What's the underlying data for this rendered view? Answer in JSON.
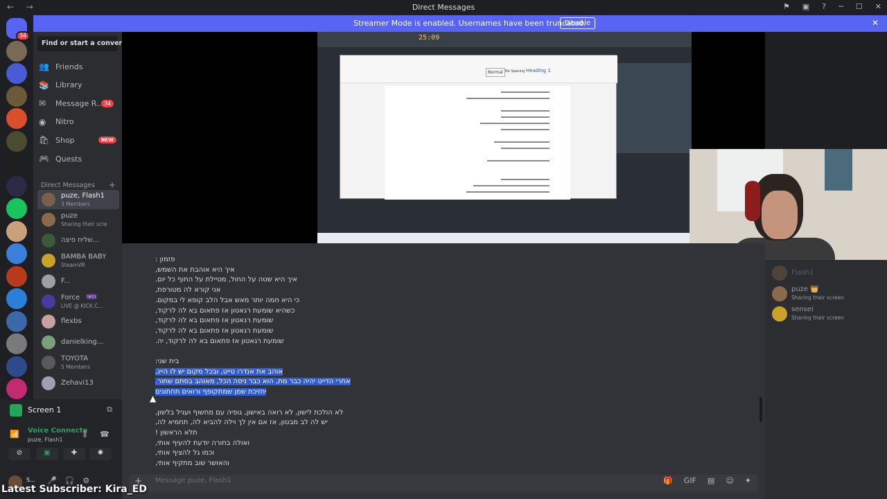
{
  "window": {
    "title": "Direct Messages",
    "back": "←",
    "forward": "→",
    "controls": [
      "─",
      "☐",
      "✕"
    ],
    "toolbar_icons": [
      "⚑",
      "▣",
      "?"
    ]
  },
  "banner": {
    "text": "Streamer Mode is enabled. Usernames have been truncated.",
    "button": "Disable",
    "close": "✕"
  },
  "guilds": {
    "home_badge": "34",
    "colors": [
      "#5865f2",
      "#7a6a55",
      "#4a5bd6",
      "#6b5a3a",
      "#d94f2b",
      "#4b4b2f",
      "#1f1f1f",
      "#2a2a44",
      "#19c35e",
      "#c8a07a",
      "#3a7fd9",
      "#b53b1c",
      "#2c7fd6",
      "#3a68a8",
      "#7a7a7a",
      "#2d4a8a",
      "#c22b6f"
    ]
  },
  "sidebar": {
    "search_placeholder": "Find or start a convers...",
    "nav": [
      {
        "label": "Friends",
        "icon": "👥"
      },
      {
        "label": "Library",
        "icon": "📚"
      },
      {
        "label": "Message R...",
        "icon": "✉",
        "count": "34"
      },
      {
        "label": "Nitro",
        "icon": "◉"
      },
      {
        "label": "Shop",
        "icon": "🛍",
        "tag": "NEW"
      },
      {
        "label": "Quests",
        "icon": "🎮"
      }
    ],
    "dm_header": "Direct Messages",
    "dm_add": "+",
    "dms": [
      {
        "name": "puze, Flash1",
        "sub": "3 Members",
        "color": "#7a6048",
        "active": true
      },
      {
        "name": "puze",
        "sub": "Sharing their scre",
        "color": "#8a6a4a",
        "live": true
      },
      {
        "name": "שליח פיצה...",
        "sub": "",
        "color": "#3a5a3a"
      },
      {
        "name": "BAMBA BABY",
        "sub": "SteamVR",
        "color": "#c9a227",
        "live": true
      },
      {
        "name": "F...",
        "sub": "",
        "color": "#9aa0a6"
      },
      {
        "name": "Force",
        "sub": "LIVE @ KICK.C...",
        "color": "#4a3aa0",
        "tag": "כושי"
      },
      {
        "name": "flexbs",
        "sub": "",
        "color": "#c8a0a0"
      },
      {
        "name": "danielking...",
        "sub": "",
        "color": "#7aa07a"
      },
      {
        "name": "TOYOTA",
        "sub": "5 Members",
        "color": "#5a5a5a"
      },
      {
        "name": "Zehavi13",
        "sub": "",
        "color": "#a0a0b0"
      }
    ]
  },
  "voice": {
    "screen_label": "Screen 1",
    "status": "Voice Connecte",
    "channel": "puze, Flash1",
    "username": "S..."
  },
  "chat": {
    "lines": [
      {
        "text": "פזמון :",
        "hl": false
      },
      {
        "text": "איך היא אוהבת את השמש,",
        "hl": false
      },
      {
        "text": "איך היא שטה על החול, מטיילת על החוף כל יום.",
        "hl": false
      },
      {
        "text": "אני קורא לה מטורפת,",
        "hl": false
      },
      {
        "text": "כי היא חמה יותר מאש אבל הלב קופא לי במקום.",
        "hl": false
      },
      {
        "text": "כשהיא שומעת רגאטון אז פתאום בא לה לרקוד,",
        "hl": false
      },
      {
        "text": "שומעת רגאטון אז פתאום בא לה לרקוד,",
        "hl": false
      },
      {
        "text": "שומעת רגאטון אז פתאום בא לה לרקוד,",
        "hl": false
      },
      {
        "text": "שומעת רגאטון אז פתאום בא לה לרקוד, יה.",
        "hl": false
      },
      {
        "text": "",
        "hl": false
      },
      {
        "text": "בית שני:",
        "hl": false
      },
      {
        "text": "אוהב את אנדרו טייט, ובכל מקום יש לו היינ,",
        "hl": true
      },
      {
        "text": "אחרי הדייט יהיה כבר מת, הוא כבר ניסה הכל, מאוהב בסתם שחור.",
        "hl": true
      },
      {
        "text": "יחזיכת שמן שמתקופף ורואים תחתונים",
        "hl": true
      },
      {
        "text": "",
        "hl": false
      },
      {
        "text": "לא הולכת לישון, לא רואה באישון, גופיה עם מחשוף ועגיל בלשון,",
        "hl": false
      },
      {
        "text": "יש לה לב מבטון, אז אם אין לך וילה להביא לה, תחמיא לה,",
        "hl": false
      },
      {
        "text": "תלא הראשון !",
        "hl": false
      },
      {
        "text": "ואולה בחורה יודעת להעיף אותי,",
        "hl": false
      },
      {
        "text": "וכמו גל להציף אותי,",
        "hl": false
      },
      {
        "text": "והאושר שוב מתקיף אותי,",
        "hl": false
      }
    ],
    "composer_placeholder": "Message puze, Flash1",
    "composer_plus": "+",
    "composer_tools": [
      "🎁",
      "GIF",
      "▤",
      "☺",
      "✦"
    ]
  },
  "stream": {
    "clock": "25:09",
    "word_styles": [
      "Normal",
      "No Spacing",
      "Heading 1"
    ]
  },
  "members": [
    {
      "name": "Flash1",
      "status": "",
      "color": "#7a6048",
      "dim": true
    },
    {
      "name": "puze 👑",
      "status": "Sharing their screen",
      "color": "#8a6a4a"
    },
    {
      "name": "sensei",
      "status": "Sharing their screen",
      "color": "#c9a227"
    }
  ],
  "overlay": {
    "subscriber": "Latest Subscriber: Kira_ED"
  }
}
